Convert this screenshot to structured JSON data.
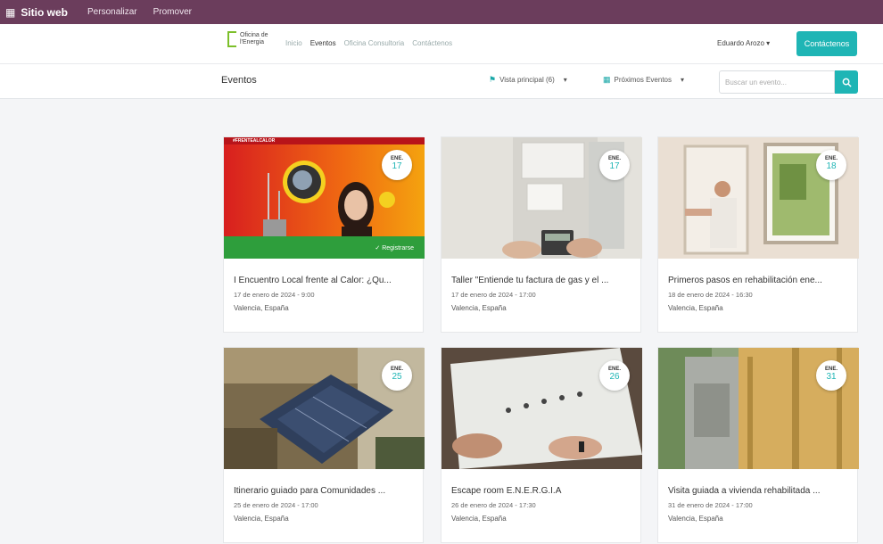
{
  "admin_bar": {
    "apps_icon": "grid-icon",
    "brand": "Sitio web",
    "menu": [
      "Personalizar",
      "Promover"
    ]
  },
  "header": {
    "logo_text": "Oficina de l'Energia",
    "nav": [
      "Inicio",
      "Eventos",
      "Oficina Consultoria",
      "Contáctenos"
    ],
    "user": "Eduardo Arozo",
    "contact_button": "Contáctenos"
  },
  "subbar": {
    "title": "Eventos",
    "filter_location": "Vista principal (6)",
    "filter_date": "Próximos Eventos",
    "search_placeholder": "Buscar un evento...",
    "search_icon": "search-icon"
  },
  "colors": {
    "admin_bar": "#6b3d5c",
    "accent": "#1fb5b5",
    "register_band": "#2e9e3c"
  },
  "events": [
    {
      "month": "ENE.",
      "day": "17",
      "title": "I Encuentro Local frente al Calor: ¿Qu...",
      "date": "17 de enero de 2024 - 9:00",
      "location": "Valencia, España",
      "banner_label": "#FRENTEALCALOR",
      "register_label": "✓ Registrarse"
    },
    {
      "month": "ENE.",
      "day": "17",
      "title": "Taller \"Entiende tu factura de gas y el ...",
      "date": "17 de enero de 2024 - 17:00",
      "location": "Valencia, España"
    },
    {
      "month": "ENE.",
      "day": "18",
      "title": "Primeros pasos en rehabilitación ene...",
      "date": "18 de enero de 2024 - 16:30",
      "location": "Valencia, España"
    },
    {
      "month": "ENE.",
      "day": "25",
      "title": "Itinerario guiado para Comunidades ...",
      "date": "25 de enero de 2024 - 17:00",
      "location": "Valencia, España"
    },
    {
      "month": "ENE.",
      "day": "26",
      "title": "Escape room E.N.E.R.G.I.A",
      "date": "26 de enero de 2024 - 17:30",
      "location": "Valencia, España"
    },
    {
      "month": "ENE.",
      "day": "31",
      "title": "Visita guiada a vivienda rehabilitada ...",
      "date": "31 de enero de 2024 - 17:00",
      "location": "Valencia, España"
    }
  ]
}
